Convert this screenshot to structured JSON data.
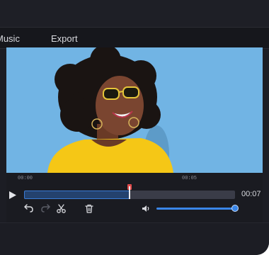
{
  "menu": {
    "items": [
      "Music",
      "Export"
    ]
  },
  "timeline": {
    "ruler_start": "00:00",
    "ruler_mid": "00:05",
    "current_time": "00:07",
    "progress": 0.5
  },
  "volume": {
    "level": 1.0
  },
  "icons": {
    "play": "play-icon",
    "undo": "undo-icon",
    "redo": "redo-icon",
    "cut": "scissors-icon",
    "delete": "trash-icon",
    "volume": "speaker-icon"
  },
  "colors": {
    "accent": "#3a86e8",
    "playhead": "#e24b4b",
    "sky": "#73b6e6"
  }
}
